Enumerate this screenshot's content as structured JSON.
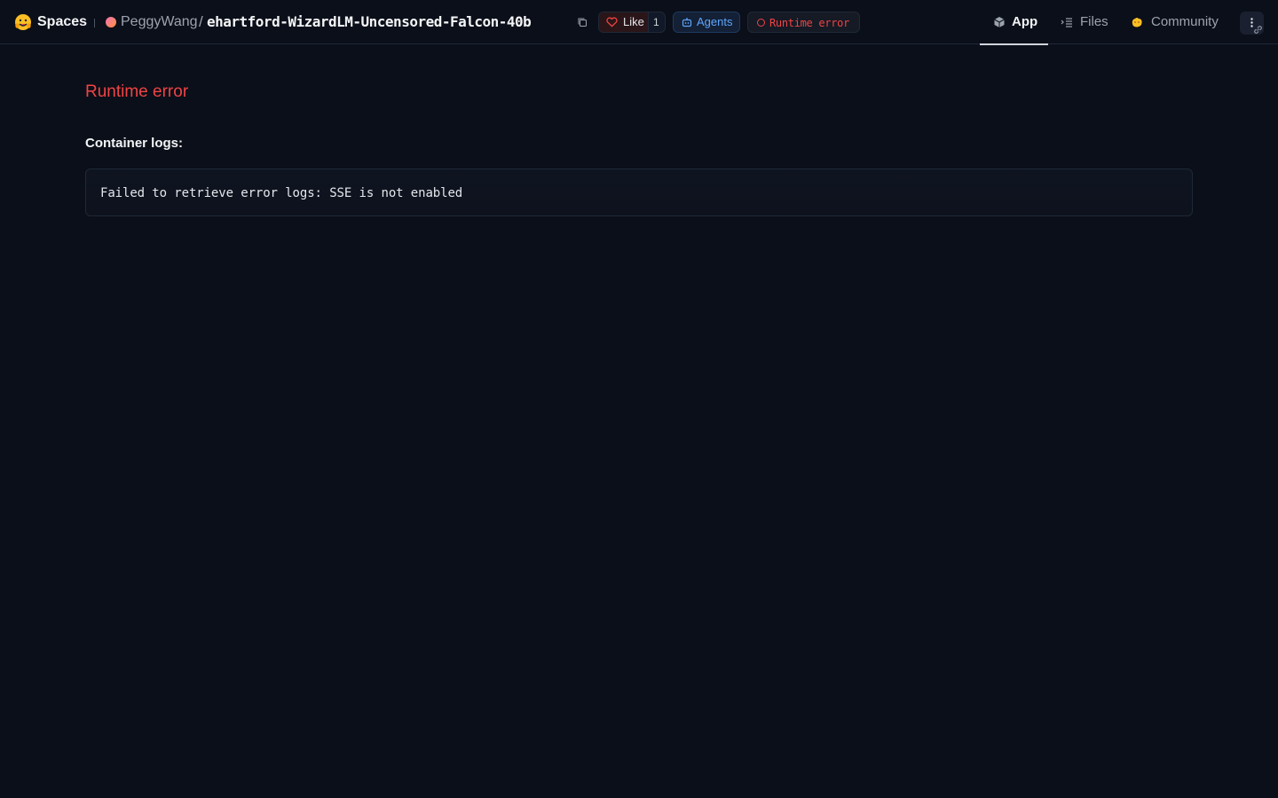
{
  "header": {
    "spaces_label": "Spaces",
    "owner": "PeggyWang",
    "separator": "/",
    "repo": "ehartford-WizardLM-Uncensored-Falcon-40b",
    "like_label": "Like",
    "like_count": "1",
    "agents_label": "Agents",
    "status_label": "Runtime error",
    "tabs": [
      {
        "label": "App",
        "icon": "cube-icon",
        "active": true
      },
      {
        "label": "Files",
        "icon": "files-icon",
        "active": false
      },
      {
        "label": "Community",
        "icon": "community-icon",
        "active": false
      }
    ]
  },
  "main": {
    "error_title": "Runtime error",
    "logs_heading": "Container logs:",
    "log_text": "Failed to retrieve error logs: SSE is not enabled"
  },
  "colors": {
    "background": "#0b0f19",
    "error": "#ef4444",
    "agents": "#60a5fa",
    "text": "#e5e7eb"
  }
}
